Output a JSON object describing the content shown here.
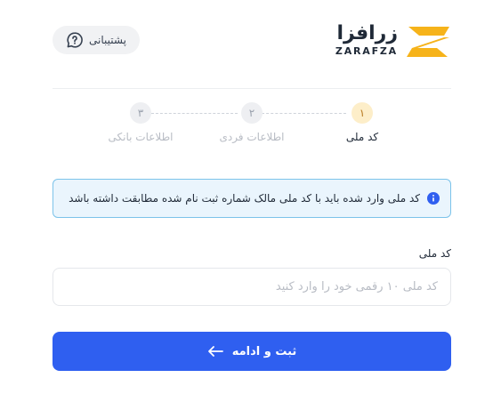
{
  "header": {
    "brand_fa": "زرافزا",
    "brand_en": "ZARAFZA",
    "support_label": "پشتیبانی",
    "support_icon": "chat-question-icon",
    "brand_color": "#f6b31a"
  },
  "stepper": {
    "steps": [
      {
        "number": "۱",
        "label": "کد ملی",
        "state": "active"
      },
      {
        "number": "۲",
        "label": "اطلاعات فردی",
        "state": "inactive"
      },
      {
        "number": "۳",
        "label": "اطلاعات بانکی",
        "state": "inactive"
      }
    ]
  },
  "alert": {
    "icon": "info-icon",
    "text": "کد ملی وارد شده باید با کد ملی مالک شماره ثبت نام شده مطابقت داشته باشد",
    "color": "#2f5ff0"
  },
  "form": {
    "national_code_label": "کد ملی",
    "national_code_value": "",
    "national_code_placeholder": "کد ملی ۱۰ رقمی خود را وارد کنید"
  },
  "submit": {
    "label": "ثبت و ادامه",
    "icon": "arrow-left-icon",
    "color": "#2f5ff0"
  }
}
